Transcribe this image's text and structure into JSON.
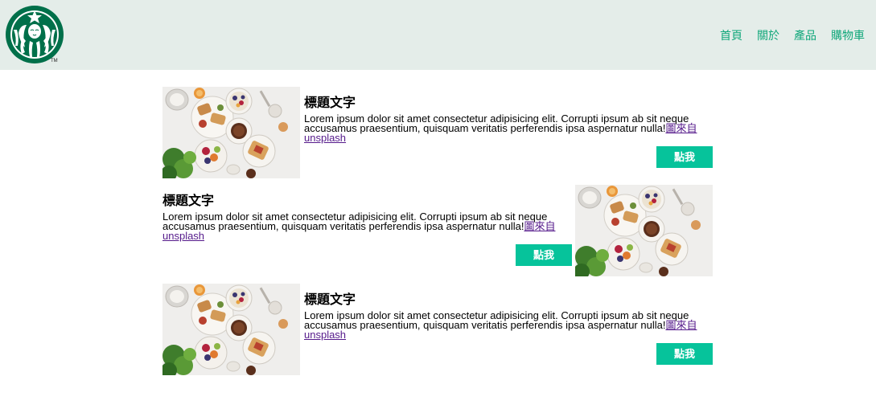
{
  "brand": {
    "logo_icon": "starbucks-siren-logo",
    "trademark": "TM",
    "colors": {
      "header_bg": "#e4ede9",
      "accent": "#06c39b",
      "nav_text": "#10a77a",
      "logo_green": "#00704a"
    }
  },
  "nav": {
    "items": [
      {
        "label": "首頁"
      },
      {
        "label": "關於"
      },
      {
        "label": "產品"
      },
      {
        "label": "購物車"
      }
    ]
  },
  "cards": [
    {
      "title": "標題文字",
      "body": "Lorem ipsum dolor sit amet consectetur adipisicing elit. Corrupti ipsum ab sit neque accusamus praesentium, quisquam veritatis perferendis ipsa aspernatur nulla!",
      "link": "圖來自unsplash",
      "button": "點我",
      "image": "food-flatlay-photo"
    },
    {
      "title": "標題文字",
      "body": "Lorem ipsum dolor sit amet consectetur adipisicing elit. Corrupti ipsum ab sit neque accusamus praesentium, quisquam veritatis perferendis ipsa aspernatur nulla!",
      "link": "圖來自unsplash",
      "button": "點我",
      "image": "food-flatlay-photo"
    },
    {
      "title": "標題文字",
      "body": "Lorem ipsum dolor sit amet consectetur adipisicing elit. Corrupti ipsum ab sit neque accusamus praesentium, quisquam veritatis perferendis ipsa aspernatur nulla!",
      "link": "圖來自unsplash",
      "button": "點我",
      "image": "food-flatlay-photo"
    }
  ]
}
